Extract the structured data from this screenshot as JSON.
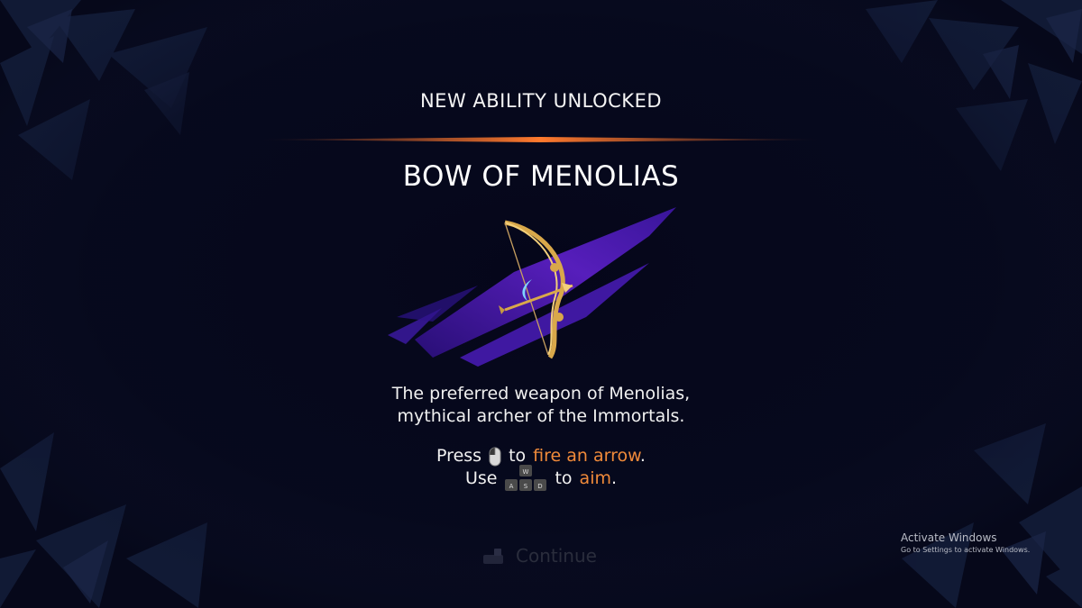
{
  "popup": {
    "header": "NEW ABILITY UNLOCKED",
    "title": "BOW OF MENOLIAS",
    "description": [
      "The preferred weapon of Menolias,",
      "mythical archer of the Immortals."
    ],
    "controls": {
      "fire": {
        "prefix": "Press",
        "connector": "to",
        "action": "fire an arrow",
        "suffix": "."
      },
      "aim": {
        "prefix": "Use",
        "connector": "to",
        "action": "aim",
        "suffix": "."
      },
      "wasd_keys": [
        "W",
        "A",
        "S",
        "D"
      ]
    },
    "continue_label": "Continue",
    "icons": {
      "ability": "bow-icon",
      "fire_input": "mouse-left-click-icon",
      "aim_input": "wasd-keys-icon",
      "continue": "gamepad-button-icon"
    }
  },
  "watermark": {
    "title": "Activate Windows",
    "subtitle": "Go to Settings to activate Windows."
  },
  "colors": {
    "background": "#06081a",
    "accent": "#f08a3a",
    "divider": "#e0632a",
    "art_stroke": "#5b1fc4",
    "bow_gold": "#d9a84a"
  }
}
